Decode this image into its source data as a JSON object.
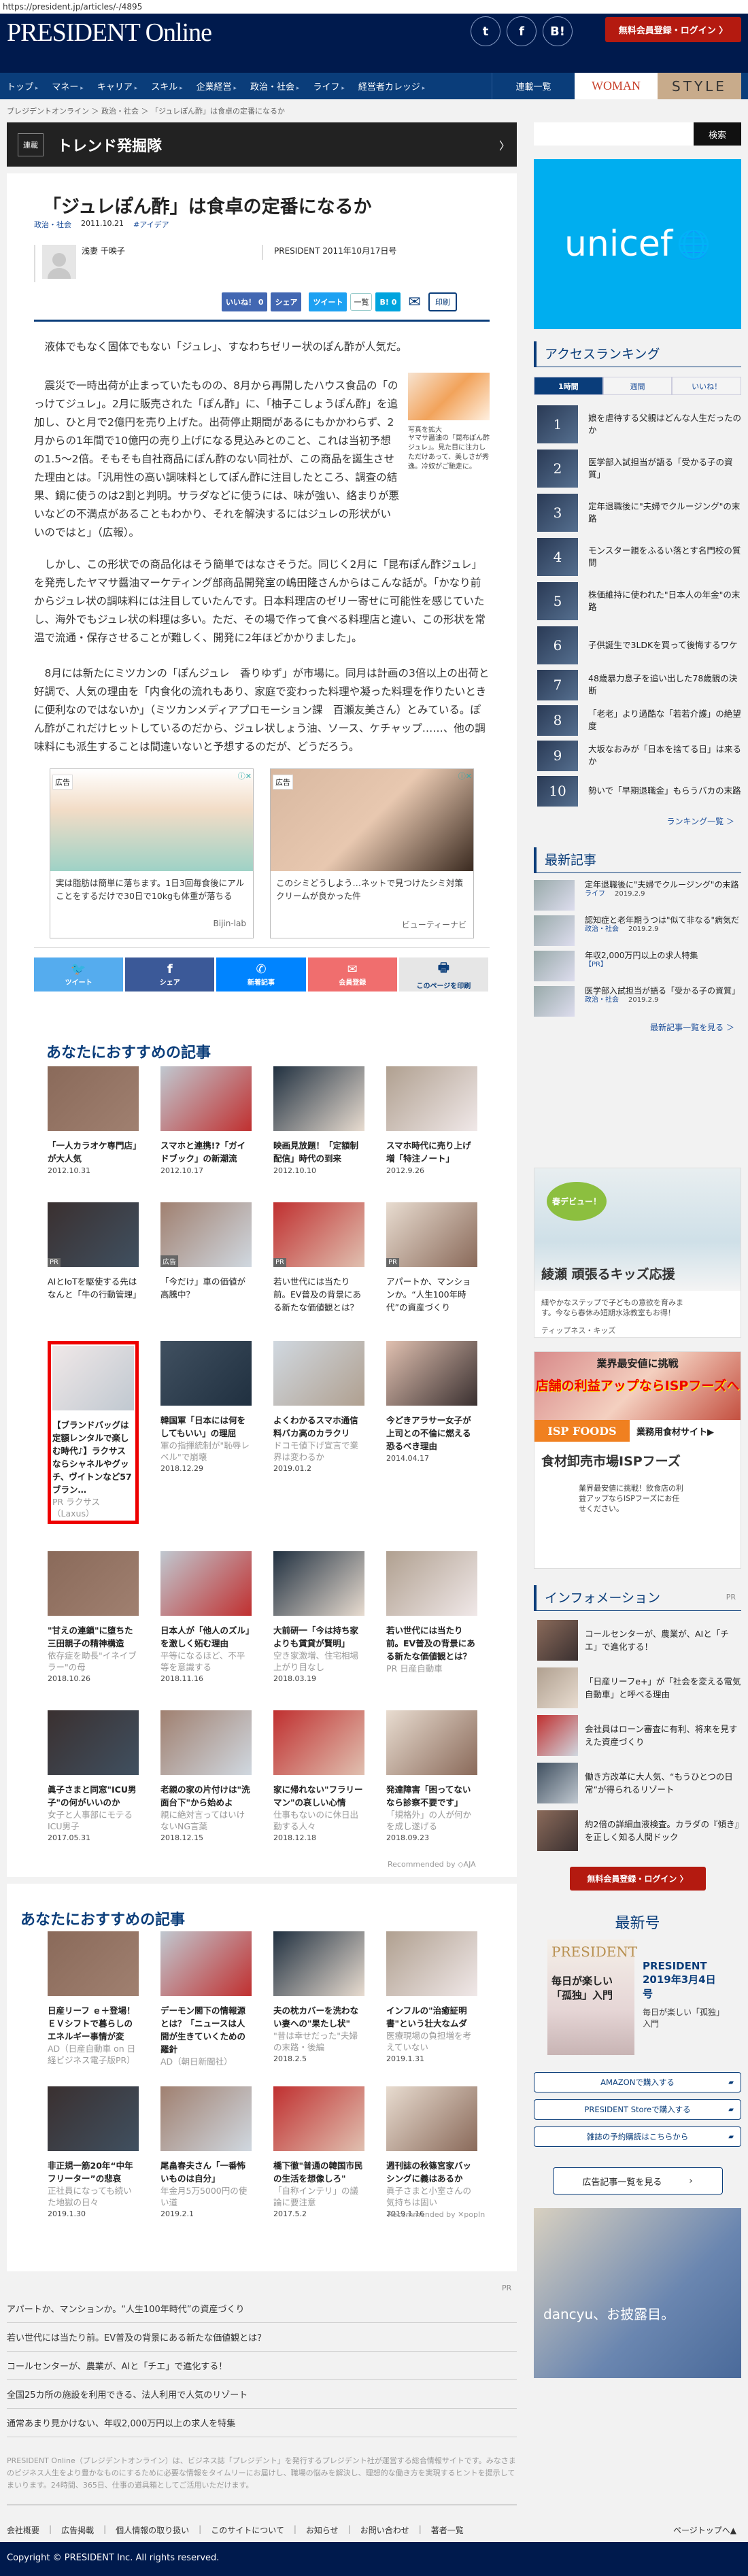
{
  "url": "https://president.jp/articles/-/4895",
  "header": {
    "logo": "PRESIDENT Online",
    "social": [
      "t",
      "f",
      "B!"
    ],
    "login_label": "無料会員登録・ログイン 〉",
    "nav": [
      "トップ",
      "マネー",
      "キャリア",
      "スキル",
      "企業経営",
      "政治・社会",
      "ライフ",
      "経営者カレッジ"
    ],
    "series_list": "連載一覧",
    "woman": "WOMAN",
    "style": "STYLE"
  },
  "breadcrumb": "プレジデントオンライン ＞ 政治・社会 ＞ 「ジュレぽん酢」は食卓の定番になるか",
  "series": {
    "tag": "連載",
    "title": "トレンド発掘隊",
    "chevron": "〉"
  },
  "search": {
    "button": "検索",
    "placeholder": ""
  },
  "article": {
    "title": "「ジュレぽん酢」は食卓の定番になるか",
    "category": "政治・社会",
    "date": "2011.10.21",
    "hashtag": "#アイデア",
    "author": "浅妻 千映子",
    "issue": "PRESIDENT 2011年10月17日号",
    "share": {
      "like": "いいね！ 0",
      "share": "シェア",
      "tweet": "ツイート",
      "list": "一覧",
      "hatena": "B! 0",
      "mail": "✉",
      "print": "印刷"
    },
    "paragraphs": [
      "液体でもなく固体でもない「ジュレ」、すなわちゼリー状のぽん酢が人気だ。",
      "震災で一時出荷が止まっていたものの、8月から再開したハウス食品の「のっけてジュレ」。2月に販売された「ぽん酢」に、「柚子こしょうぽん酢」を追加し、ひと月で2億円を売り上げた。出荷停止期間があるにもかかわらず、2月からの1年間で10億円の売り上げになる見込みとのこと、これは当初予想の1.5〜2倍。そもそも自社商品にぽん酢のない同社が、この商品を誕生させた理由とは。「汎用性の高い調味料としてぽん酢に注目したところ、調査の結果、鍋に使うのは2割と判明。サラダなどに使うには、味が強い、絡まりが悪いなどの不満点があることもわかり、それを解決するにはジュレの形状がいいのではと」（広報）。",
      "しかし、この形状での商品化はそう簡単ではなさそうだ。同じく2月に「昆布ぽん酢ジュレ」を発売したヤマサ醤油マーケティング部商品開発室の嶋田隆さんからはこんな話が。「かなり前からジュレ状の調味料には注目していたんです。日本料理店のゼリー寄せに可能性を感じていたし、海外でもジュレ状の料理は多い。ただ、その場で作って食べる料理店と違い、この形状を常温で流通・保存させることが難しく、開発に2年ほどかかりました」。",
      "8月には新たにミツカンの「ぽんジュレ　香りゆず」が市場に。同月は計画の3倍以上の出荷と好調で、人気の理由を「内食化の流れもあり、家庭で変わった料理や凝った料理を作りたいときに便利なのではないか」（ミツカンメディアプロモーション課　百瀬友美さん）とみている。ぽん酢がこれだけヒットしているのだから、ジュレ状しょう油、ソース、ケチャップ……、他の調味料にも派生することは間違いないと予想するのだが、どうだろう。"
    ],
    "photo": {
      "link": "写真を拡大",
      "caption": "ヤマサ醤油の「昆布ぽん酢ジュレ」。見た目に注力しただけあって、美しさが秀逸。冷奴がご馳走に。"
    }
  },
  "ads": [
    {
      "label": "広告",
      "text": "実は脂肪は簡単に落ちます。1日3回毎食後にアルことをするだけで30日で10kgも体重が落ちる",
      "source": "Bijin-lab"
    },
    {
      "label": "広告",
      "text": "このシミどうしよう…ネットで見つけたシミ対策クリームが良かった件",
      "source": "ビューティーナビ"
    }
  ],
  "share_buttons": [
    {
      "icon": "twitter-icon",
      "glyph": "🐦",
      "label": "ツイート",
      "color": "#55acee"
    },
    {
      "icon": "facebook-icon",
      "glyph": "f",
      "label": "シェア",
      "color": "#3b5998"
    },
    {
      "icon": "messenger-icon",
      "glyph": "✆",
      "label": "新着記事",
      "color": "#0084ff"
    },
    {
      "icon": "mail-icon",
      "glyph": "✉",
      "label": "会員登録",
      "color": "#f06e6e"
    },
    {
      "icon": "print-icon",
      "glyph": "🖶",
      "label": "このページを印刷",
      "color": "#e6e6e6"
    }
  ],
  "recs1": {
    "title": "あなたにおすすめの記事",
    "items": [
      {
        "title": "「一人カラオケ専門店」が大人気",
        "date": "2012.10.31"
      },
      {
        "title": "スマホと連携!?「ガイドブック」の新潮流",
        "date": "2012.10.17"
      },
      {
        "title": "映画見放題！「定額制配信」時代の到来",
        "date": "2012.10.10"
      },
      {
        "title": "スマホ時代に売り上げ増「特注ノート」",
        "date": "2012.9.26"
      },
      {
        "title": "AIとIoTを駆使する先はなんと「牛の行動管理」",
        "badge": "PR",
        "plain": true
      },
      {
        "title": "「今だけ」車の価値が高騰中？",
        "badge": "広告",
        "plain": true
      },
      {
        "title": "若い世代には当たり前。EV普及の背景にある新たな価値観とは？",
        "badge": "PR",
        "plain": true
      },
      {
        "title": "アパートか、マンションか。“人生100年時代”の資産づくり",
        "badge": "PR",
        "plain": true
      },
      {
        "title": "【ブランドバッグは定額レンタルで楽しむ時代♪】ラクサスならシャネルやグッチ、ヴイトンなど57ブラン…",
        "sub": "PR ラクサス（Laxus）",
        "red": true
      },
      {
        "title": "韓国軍「日本には何をしてもいい」の理屈",
        "sub": "軍の指揮統制が\"恥辱レベル\"で崩壊",
        "date": "2018.12.29"
      },
      {
        "title": "よくわかるスマホ通信料バカ高のカラクリ",
        "sub": "ドコモ値下げ宣言で業界は変わるか",
        "date": "2019.01.2"
      },
      {
        "title": "今どきアラサー女子が上司との不倫に燃える恐るべき理由",
        "date": "2014.04.17"
      },
      {
        "title": "\"甘えの連鎖\"に堕ちた三田親子の精神構造",
        "sub": "依存症を助長\"イネイブラー\"の母",
        "date": "2018.10.26"
      },
      {
        "title": "日本人が「他人のズル」を激しく妬む理由",
        "sub": "平等になるほど、不平等を意識する",
        "date": "2018.11.16"
      },
      {
        "title": "大前研一「今は持ち家よりも賃貸が賢明」",
        "sub": "空き家激増、住宅相場上がり目なし",
        "date": "2018.03.19"
      },
      {
        "title": "若い世代には当たり前。EV普及の背景にある新たな価値観とは？",
        "sub": "PR 日産自動車"
      },
      {
        "title": "眞子さまと同窓\"ICU男子\"の何がいいのか",
        "sub": "女子と人事部にモテるICU男子",
        "date": "2017.05.31"
      },
      {
        "title": "老親の家の片付けは\"洗面台下\"から始めよ",
        "sub": "親に絶対言ってはいけないNG言葉",
        "date": "2018.12.15"
      },
      {
        "title": "家に帰れない\"フラリーマン\"の哀しい心情",
        "sub": "仕事もないのに休日出勤する人々",
        "date": "2018.12.18"
      },
      {
        "title": "発達障害「困ってないなら診察不要です」",
        "sub": "「規格外」の人が何かを成し遂げる",
        "date": "2018.09.23"
      }
    ],
    "recommended_by": "Recommended by ◇AJA"
  },
  "recs2": {
    "title": "あなたにおすすめの記事",
    "items": [
      {
        "title": "日産リーフ ｅ＋登場！　ＥＶシフトで暮らしのエネルギー事情が変",
        "sub": "AD（日産自動車 on 日経ビジネス電子版PR）"
      },
      {
        "title": "デーモン閣下の情報源とは？「ニュースは人間が生きていくための羅針",
        "sub": "AD（朝日新聞社）"
      },
      {
        "title": "夫の枕カバーを洗わない妻への\"果たし状\"",
        "sub": "\"昔は幸せだった\"夫婦の末路・後編",
        "date": "2018.2.5"
      },
      {
        "title": "インフルの\"治癒証明書\"という壮大なムダ",
        "sub": "医療現場の負担増を考えていない",
        "date": "2019.1.31"
      },
      {
        "title": "非正規一筋20年“中年フリーター”の悲哀",
        "sub": "正社員になっても続いた地獄の日々",
        "date": "2019.1.30"
      },
      {
        "title": "尾畠春夫さん「一番怖いものは自分」",
        "sub": "年金月5万5000円の使い道",
        "date": "2019.2.1"
      },
      {
        "title": "橋下徹\"普通の韓国市民の生活を想像しろ\"",
        "sub": "「自称インテリ」の議論に要注意",
        "date": "2017.5.2"
      },
      {
        "title": "週刊誌の秋篠宮家バッシングに義はあるか",
        "sub": "眞子さまと小室さんの気持ちは固い",
        "date": "2019.1.16"
      }
    ],
    "recommended_by": "Recommended by ✕popIn"
  },
  "pr_links": {
    "label": "PR",
    "items": [
      "アパートか、マンションか。“人生100年時代”の資産づくり",
      "若い世代には当たり前。EV普及の背景にある新たな価値観とは？",
      "コールセンターが、農業が、AIと「チエ」で進化する！",
      "全国25カ所の施設を利用できる、法人利用で人気のリゾート",
      "通常あまり見かけない、年収2,000万円以上の求人を特集"
    ]
  },
  "about": "PRESIDENT Online（プレジデントオンライン）は、ビジネス誌「プレジデント」を発行するプレジデント社が運営する総合情報サイトです。みなさまのビジネス人生をより豊かなものにするために必要な情報をタイムリーにお届けし、職場の悩みを解決し、理想的な働き方を実現するヒントを提示してまいります。24時間、365日、仕事の道具箱としてご活用いただけます。",
  "footer": {
    "links": [
      "会社概要",
      "広告掲載",
      "個人情報の取り扱い",
      "このサイトについて",
      "お知らせ",
      "お問い合わせ",
      "著者一覧"
    ],
    "pagetop": "ページトップへ▲",
    "copyright": "Copyright © PRESIDENT Inc. All rights reserved."
  },
  "sidebar": {
    "unicef": "unicef",
    "ranking": {
      "title": "アクセスランキング",
      "tabs": [
        "1時間",
        "週間",
        "いいね！"
      ],
      "items": [
        "娘を虐待する父親はどんな人生だったのか",
        "医学部入試担当が語る「受かる子の資質」",
        "定年退職後に\"夫婦でクルージング\"の末路",
        "モンスター親をふるい落とす名門校の質問",
        "株価維持に使われた\"日本人の年金\"の末路",
        "子供誕生で3LDKを買って後悔するワケ",
        "48歳暴力息子を追い出した78歳親の決断",
        "「老老」より過酷な「若若介護」の絶望度",
        "大坂なおみが「日本を捨てる日」は来るか",
        "勢いで「早期退職金」もらうバカの末路"
      ],
      "more": "ランキング一覧 ＞"
    },
    "latest": {
      "title": "最新記事",
      "items": [
        {
          "title": "定年退職後に\"夫婦でクルージング\"の末路",
          "cat": "ライフ",
          "date": "2019.2.9"
        },
        {
          "title": "認知症と老年期うつは\"似て非なる\"病気だ",
          "cat": "政治・社会",
          "date": "2019.2.9"
        },
        {
          "title": "年収2,000万円以上の求人特集",
          "cat": "【PR】",
          "date": ""
        },
        {
          "title": "医学部入試担当が語る「受かる子の資質」",
          "cat": "政治・社会",
          "date": "2019.2.9"
        }
      ],
      "more": "最新記事一覧を見る ＞"
    },
    "ad1": {
      "badge": "春デビュー！",
      "title": "綾瀬 頑張るキッズ応援",
      "text": "細やかなステップで子どもの意欲を育みます。今なら春休み短期水泳教室もお得！",
      "source": "ティップネス・キッズ"
    },
    "ad2": {
      "headline": "業界最安値に挑戦",
      "banner": "店舗の利益アップならISPフーズへ",
      "brand": "ISP FOODS",
      "site": "業務用食材サイト▶",
      "title": "食材卸売市場ISPフーズ",
      "text": "業界最安値に挑戦！飲食店の利益アップならISPフーズにお任せください。"
    },
    "info": {
      "title": "インフォメーション",
      "pr": "PR",
      "items": [
        "コールセンターが、農業が、AIと「チエ」で進化する！",
        "「日産リーフe+」が「社会を変える電気自動車」と呼べる理由",
        "会社員はローン審査に有利、将来を見すえた資産づくり",
        "働き方改革に大人気、“もうひとつの日常”が得られるリゾート",
        "約2倍の詳細血液検査。カラダの『傾き』を正しく知る人間ドック"
      ]
    },
    "login_label": "無料会員登録・ログイン 〉",
    "issue": {
      "heading": "最新号",
      "cover_title": "毎日が楽しい「孤独」入門",
      "name": "PRESIDENT 2019年3月4日号",
      "desc": "毎日が楽しい「孤独」入門",
      "buttons": [
        "AMAZONで購入する",
        "PRESIDENT Storeで購入する",
        "雑誌の予約購読はこちらから"
      ],
      "ad_list": "広告記事一覧を見る"
    },
    "dancyu": "dancyu、お披露目。"
  },
  "colors": {
    "navy": "#001a4d",
    "nav": "#0a3d7a",
    "accent_red": "#b41a10",
    "unicef": "#00aeef"
  }
}
